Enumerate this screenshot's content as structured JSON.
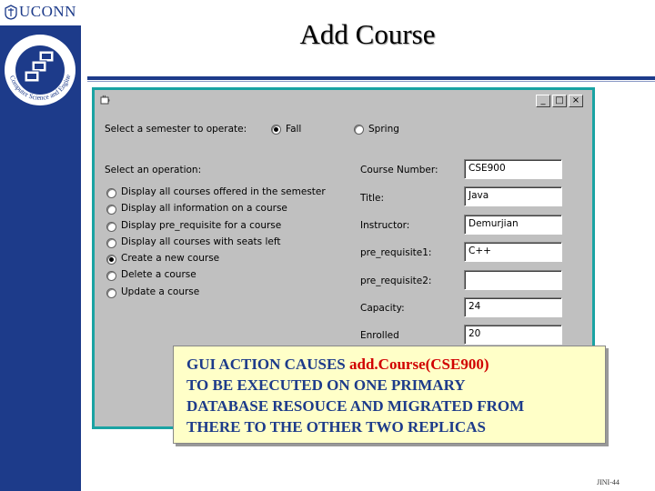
{
  "branding": {
    "logo_text": "UCONN",
    "badge_text": "Computer Science and Engineering"
  },
  "slide": {
    "title": "Add Course",
    "footer": "JINI-44"
  },
  "window": {
    "buttons": [
      "_",
      "□",
      "×"
    ]
  },
  "semester": {
    "prompt": "Select a semester to operate:",
    "options": [
      {
        "label": "Fall",
        "selected": true
      },
      {
        "label": "Spring",
        "selected": false
      }
    ]
  },
  "operations": {
    "prompt": "Select an operation:",
    "items": [
      {
        "label": "Display all courses offered in the semester",
        "selected": false
      },
      {
        "label": "Display all information on a course",
        "selected": false
      },
      {
        "label": "Display pre_requisite for a course",
        "selected": false
      },
      {
        "label": "Display all courses with seats left",
        "selected": false
      },
      {
        "label": "Create a new course",
        "selected": true
      },
      {
        "label": "Delete a course",
        "selected": false
      },
      {
        "label": "Update a course",
        "selected": false
      }
    ]
  },
  "form": {
    "fields": [
      {
        "label": "Course Number:",
        "value": "CSE900"
      },
      {
        "label": "Title:",
        "value": "Java"
      },
      {
        "label": "Instructor:",
        "value": "Demurjian"
      },
      {
        "label": "pre_requisite1:",
        "value": "C++"
      },
      {
        "label": "pre_requisite2:",
        "value": ""
      },
      {
        "label": "Capacity:",
        "value": "24"
      },
      {
        "label": "Enrolled",
        "value": "20"
      }
    ]
  },
  "callout": {
    "line1_prefix": "GUI ACTION CAUSES ",
    "line1_highlight": "add.Course(CSE900)",
    "line2": "TO BE EXECUTED ON ONE PRIMARY",
    "line3": "DATABASE RESOUCE AND MIGRATED FROM",
    "line4": "THERE TO THE OTHER TWO REPLICAS"
  },
  "colors": {
    "brand_blue": "#1d3b8a",
    "window_border": "#1aa3a3",
    "window_bg": "#c0c0c0",
    "callout_bg": "#ffffc8",
    "highlight_red": "#d10000"
  }
}
